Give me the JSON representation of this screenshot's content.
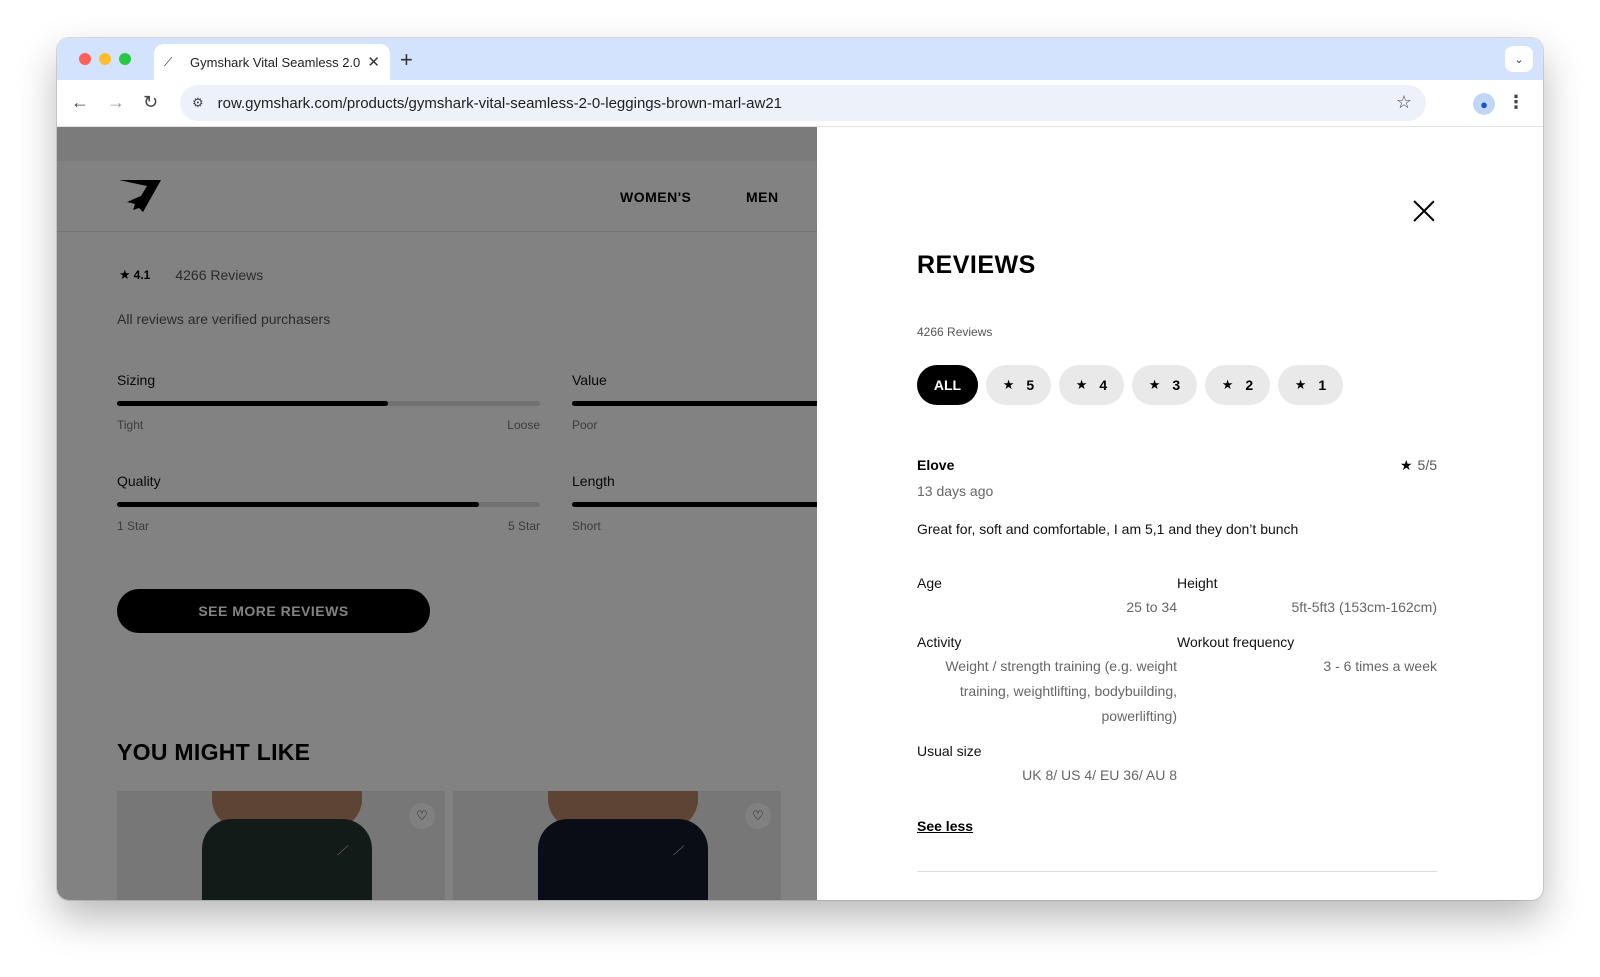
{
  "browser": {
    "tab_title": "Gymshark Vital Seamless 2.0",
    "url": "row.gymshark.com/products/gymshark-vital-seamless-2-0-leggings-brown-marl-aw21"
  },
  "header": {
    "nav_women": "WOMEN'S",
    "nav_men": "MEN"
  },
  "summary": {
    "rating": "4.1",
    "review_count": "4266 Reviews",
    "verified_note": "All reviews are verified purchasers",
    "attributes": [
      {
        "label": "Sizing",
        "left": "Tight",
        "right": "Loose",
        "fill_fraction": 0.64
      },
      {
        "label": "Value",
        "left": "Poor",
        "right": "",
        "fill_fraction": 0.8
      },
      {
        "label": "Quality",
        "left": "1 Star",
        "right": "5 Star",
        "fill_fraction": 0.855
      },
      {
        "label": "Length",
        "left": "Short",
        "right": "",
        "fill_fraction": 0.8
      }
    ],
    "see_more_label": "SEE MORE REVIEWS"
  },
  "recommendations": {
    "title": "YOU MIGHT LIKE",
    "colors": [
      "#24362f",
      "#151a2a"
    ]
  },
  "drawer": {
    "title": "REVIEWS",
    "count": "4266 Reviews",
    "filters": [
      {
        "label": "ALL",
        "star": false,
        "active": true
      },
      {
        "label": "5",
        "star": true,
        "active": false
      },
      {
        "label": "4",
        "star": true,
        "active": false
      },
      {
        "label": "3",
        "star": true,
        "active": false
      },
      {
        "label": "2",
        "star": true,
        "active": false
      },
      {
        "label": "1",
        "star": true,
        "active": false
      }
    ],
    "review": {
      "name": "Elove",
      "score": "5/5",
      "date": "13 days ago",
      "text": "Great for, soft and comfortable, I am 5,1 and they don’t bunch",
      "age_label": "Age",
      "age_value": "25 to 34",
      "height_label": "Height",
      "height_value": "5ft-5ft3 (153cm-162cm)",
      "activity_label": "Activity",
      "activity_value": "Weight / strength training (e.g. weight training, weightlifting, bodybuilding, powerlifting)",
      "frequency_label": "Workout frequency",
      "frequency_value": "3 - 6 times a week",
      "size_label": "Usual size",
      "size_value": "UK 8/ US 4/ EU 36/ AU 8",
      "see_less": "See less"
    }
  },
  "colors": {
    "accent": "#000000",
    "chip_bg": "#e9e9e9",
    "tabbar_bg": "#d3e3fd"
  }
}
